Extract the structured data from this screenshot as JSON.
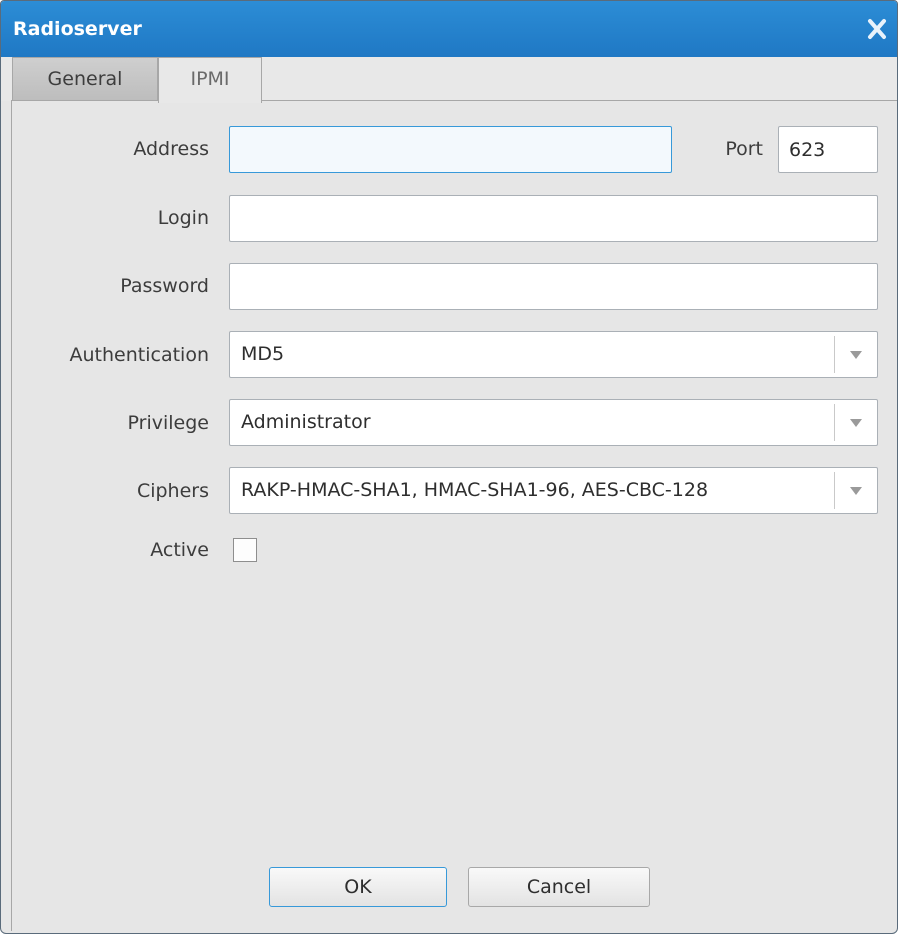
{
  "window": {
    "title": "Radioserver",
    "close_icon": "close-icon"
  },
  "tabs": [
    {
      "label": "General",
      "selected": false
    },
    {
      "label": "IPMI",
      "selected": true
    }
  ],
  "form": {
    "address": {
      "label": "Address",
      "value": ""
    },
    "port": {
      "label": "Port",
      "value": "623"
    },
    "login": {
      "label": "Login",
      "value": ""
    },
    "password": {
      "label": "Password",
      "value": ""
    },
    "authentication": {
      "label": "Authentication",
      "value": "MD5"
    },
    "privilege": {
      "label": "Privilege",
      "value": "Administrator"
    },
    "ciphers": {
      "label": "Ciphers",
      "value": "RAKP-HMAC-SHA1, HMAC-SHA1-96, AES-CBC-128"
    },
    "active": {
      "label": "Active",
      "checked": false
    }
  },
  "buttons": {
    "ok": "OK",
    "cancel": "Cancel"
  },
  "colors": {
    "title_bar": "#1f78c4",
    "focus_border": "#3799d9",
    "background": "#e6e6e6"
  }
}
